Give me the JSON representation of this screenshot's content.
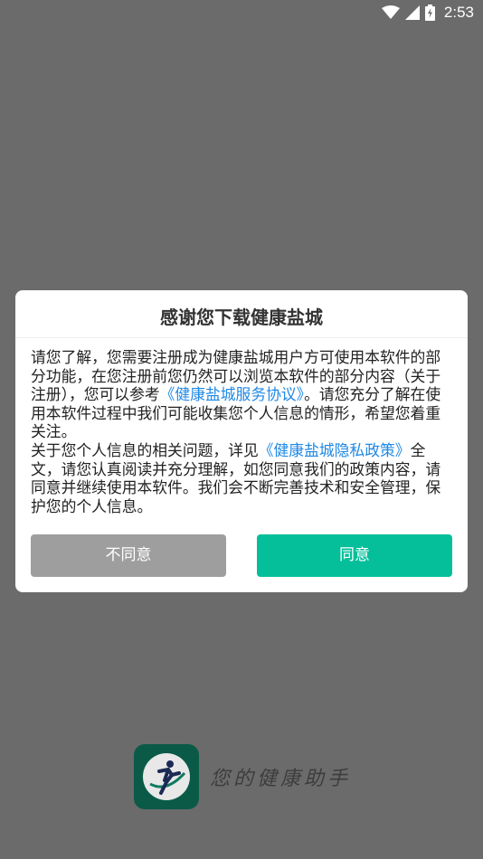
{
  "status_bar": {
    "time": "2:53",
    "icons": [
      "wifi-icon",
      "cell-signal-icon",
      "battery-icon"
    ]
  },
  "dialog": {
    "title": "感谢您下载健康盐城",
    "para1_a": "请您了解，您需要注册成为健康盐城用户方可使用本软件的部分功能，在您注册前您仍然可以浏览本软件的部分内容（关于注册），您可以参考",
    "service_link": "《健康盐城服务协议》",
    "para1_b": "。请您充分了解在使用本软件过程中我们可能收集您个人信息的情形，希望您着重关注。",
    "para2_a": "关于您个人信息的相关问题，详见",
    "privacy_link": "《健康盐城隐私政策》",
    "para2_b": "全文，请您认真阅读并充分理解，如您同意我们的政策内容，请同意并继续使用本软件。我们会不断完善技术和安全管理，保护您的个人信息。",
    "disagree_label": "不同意",
    "agree_label": "同意"
  },
  "splash": {
    "logo": "health-runner-logo-icon",
    "slogan": "您的健康助手"
  },
  "colors": {
    "overlay": "#6b6b6b",
    "agree_button": "#05bf9a",
    "disagree_button": "#9e9e9e",
    "link": "#1e88e5",
    "logo_bg": "#0a5a47"
  }
}
